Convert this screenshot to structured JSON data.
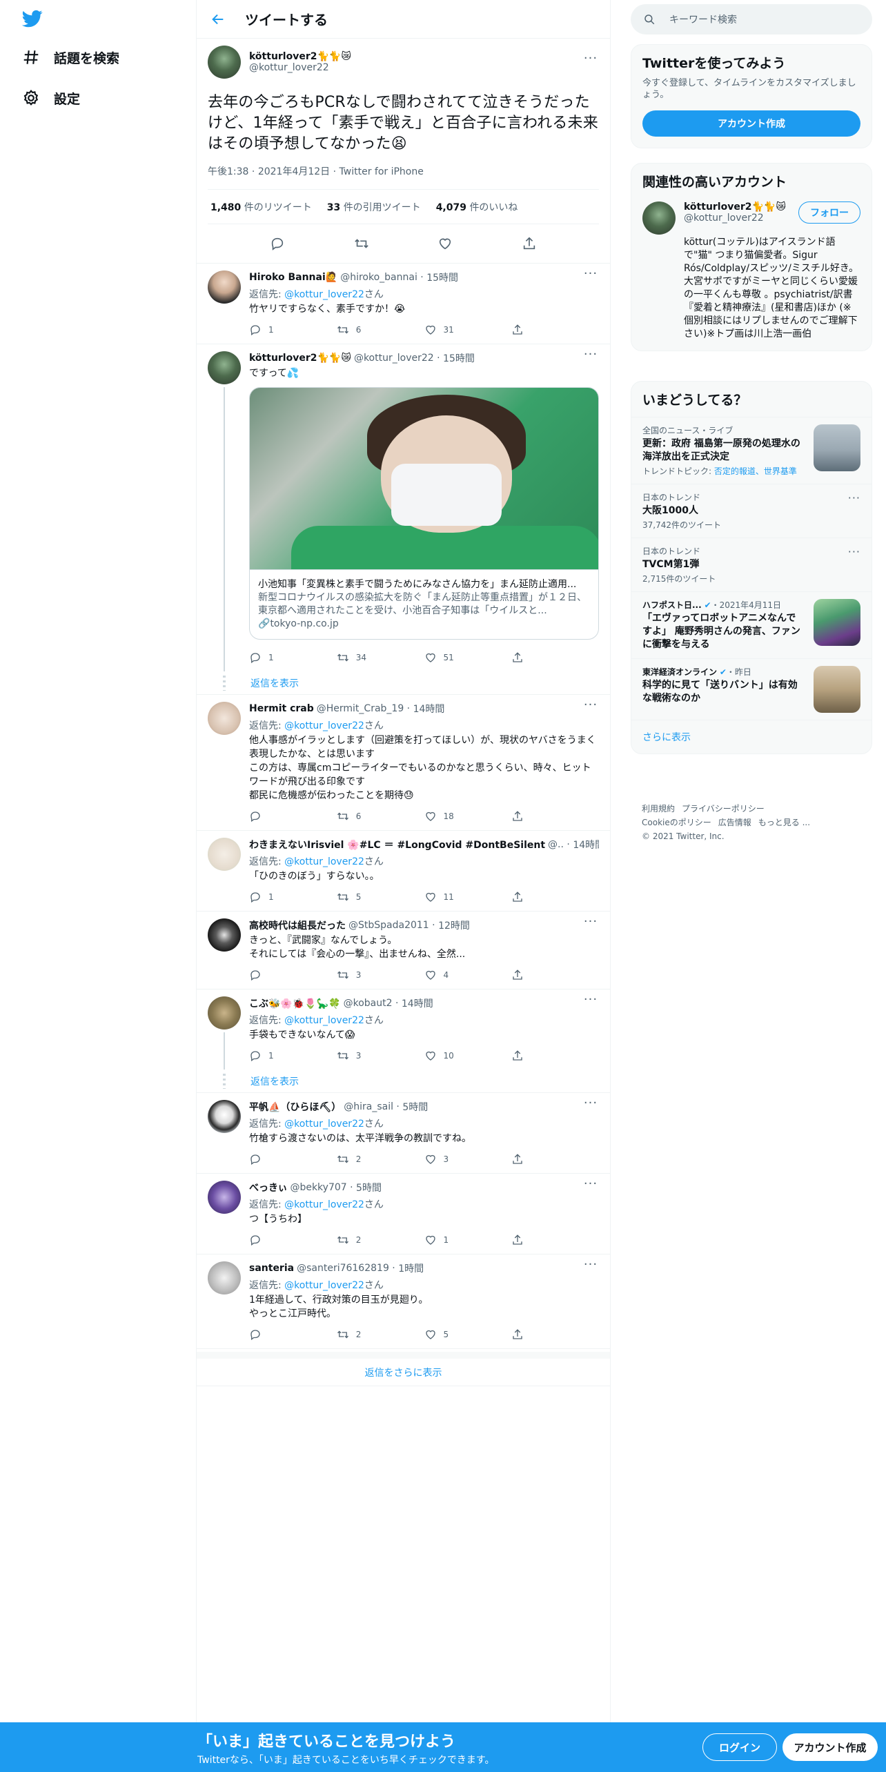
{
  "nav": {
    "explore": "話題を検索",
    "settings": "設定"
  },
  "header": {
    "title": "ツイートする"
  },
  "focal": {
    "name": "kötturlover2🐈🐈😿",
    "handle": "@kottur_lover22",
    "text": "去年の今ごろもPCRなしで闘わされてて泣きそうだったけど、1年経って「素手で戦え」と百合子に言われる未来はその頃予想してなかった😫",
    "time": "午後1:38",
    "date": "2021年4月12日",
    "client": "Twitter for iPhone",
    "retweets": "1,480",
    "retweets_label": "件のリツイート",
    "quotes": "33",
    "quotes_label": "件の引用ツイート",
    "likes": "4,079",
    "likes_label": "件のいいね"
  },
  "replies": [
    {
      "name": "Hiroko Bannai🙋",
      "handle": "@hiroko_bannai",
      "time": "15時間",
      "replyto": "返信先: ",
      "replyto_user": "@kottur_lover22",
      "replyto_suffix": "さん",
      "text": "竹ヤリですらなく、素手ですか！😭",
      "reply_count": "1",
      "rt_count": "6",
      "like_count": "31"
    },
    {
      "name": "kötturlover2🐈🐈😿",
      "handle": "@kottur_lover22",
      "time": "15時間",
      "text": "ですって💦",
      "reply_count": "1",
      "rt_count": "34",
      "like_count": "51",
      "card": {
        "title": "小池知事「変異株と素手で闘うためにみなさん協力を」まん延防止適用...",
        "desc": "新型コロナウイルスの感染拡大を防ぐ「まん延防止等重点措置」が１２日、東京都へ適用されたことを受け、小池百合子知事は「ウイルスと...",
        "url": "tokyo-np.co.jp"
      }
    },
    {
      "name": "Hermit crab",
      "handle": "@Hermit_Crab_19",
      "time": "14時間",
      "replyto": "返信先: ",
      "replyto_user": "@kottur_lover22",
      "replyto_suffix": "さん",
      "text": "他人事感がイラッとします（回避策を打ってほしい）が、現状のヤバさをうまく表現したかな、とは思います\nこの方は、専属cmコピーライターでもいるのかなと思うくらい、時々、ヒットワードが飛び出る印象です\n都民に危機感が伝わったことを期待😓",
      "reply_count": "",
      "rt_count": "6",
      "like_count": "18"
    },
    {
      "name": "わきまえないIrisviel 🌸#LC ＝ #LongCovid #DontBeSilent",
      "handle": "@..",
      "time": "14時間",
      "replyto": "返信先: ",
      "replyto_user": "@kottur_lover22",
      "replyto_suffix": "さん",
      "text": "「ひのきのぼう」すらない。。",
      "reply_count": "1",
      "rt_count": "5",
      "like_count": "11"
    },
    {
      "name": "高校時代は組長だった",
      "handle": "@StbSpada2011",
      "time": "12時間",
      "text": "きっと、『武闘家』なんでしょう。\nそれにしては『会心の一撃』、出ませんね、全然...",
      "reply_count": "",
      "rt_count": "3",
      "like_count": "4"
    },
    {
      "name": "こぶ🐝🌸🐞🌷🦕🍀",
      "handle": "@kobaut2",
      "time": "14時間",
      "replyto": "返信先: ",
      "replyto_user": "@kottur_lover22",
      "replyto_suffix": "さん",
      "text": "手袋もできないなんて😱",
      "reply_count": "1",
      "rt_count": "3",
      "like_count": "10"
    },
    {
      "name": "平帆⛵（ひらほ⛏）",
      "handle": "@hira_sail",
      "time": "5時間",
      "replyto": "返信先: ",
      "replyto_user": "@kottur_lover22",
      "replyto_suffix": "さん",
      "text": "竹槍すら渡さないのは、太平洋戦争の教訓ですね。",
      "reply_count": "",
      "rt_count": "2",
      "like_count": "3"
    },
    {
      "name": "べっきぃ",
      "handle": "@bekky707",
      "time": "5時間",
      "replyto": "返信先: ",
      "replyto_user": "@kottur_lover22",
      "replyto_suffix": "さん",
      "text": "つ【うちわ】",
      "reply_count": "",
      "rt_count": "2",
      "like_count": "1"
    },
    {
      "name": "santeria",
      "handle": "@santeri76162819",
      "time": "1時間",
      "replyto": "返信先: ",
      "replyto_user": "@kottur_lover22",
      "replyto_suffix": "さん",
      "text": "1年経過して、行政対策の目玉が見廻り。\nやっとこ江戸時代。",
      "reply_count": "",
      "rt_count": "2",
      "like_count": "5"
    }
  ],
  "show_replies": "返信を表示",
  "more_replies": "返信をさらに表示",
  "search": {
    "placeholder": "キーワード検索"
  },
  "signup": {
    "title": "Twitterを使ってみよう",
    "desc": "今すぐ登録して、タイムラインをカスタマイズしましょう。",
    "button": "アカウント作成"
  },
  "relevant": {
    "title": "関連性の高いアカウント",
    "name": "kötturlover2🐈🐈😿",
    "handle": "@kottur_lover22",
    "follow": "フォロー",
    "bio": "köttur(コッテル)はアイスランド語で\"猫\" つまり猫偏愛者。Sigur Rós/Coldplay/スピッツ/ミスチル好き。大宮サポですがミーヤと同じくらい愛媛の一平くんも尊敬 。psychiatrist/訳書 『愛着と精神療法』(星和書店)ほか (※個別相談にはリプしませんのでご理解下さい)※トプ画は川上浩一画伯"
  },
  "trends": {
    "title": "いまどうしてる？",
    "items": [
      {
        "meta": "全国のニュース・ライブ",
        "title": "更新：政府 福島第一原発の処理水の海洋放出を正式決定",
        "sub_prefix": "トレンドトピック: ",
        "sub_links": "否定的報道、世界基準"
      },
      {
        "meta": "日本のトレンド",
        "title": "大阪1000人",
        "sub": "37,742件のツイート"
      },
      {
        "meta": "日本のトレンド",
        "title": "TVCM第1弾",
        "sub": "2,715件のツイート"
      },
      {
        "meta_source": "ハフポスト日...",
        "meta_date": "・2021年4月11日",
        "title": "「エヴァってロボットアニメなんですよ」 庵野秀明さんの発言、ファンに衝撃を与える"
      },
      {
        "meta_source": "東洋経済オンライン",
        "meta_date": "・昨日",
        "title": "科学的に見て「送りバント」は有効な戦術なのか"
      }
    ],
    "more": "さらに表示"
  },
  "footer": {
    "links": [
      "利用規約",
      "プライバシーポリシー",
      "Cookieのポリシー",
      "広告情報",
      "もっと見る ..."
    ],
    "copyright": "© 2021 Twitter, Inc."
  },
  "bottombar": {
    "title": "「いま」起きていることを見つけよう",
    "sub": "Twitterなら、「いま」起きていることをいち早くチェックできます。",
    "login": "ログイン",
    "signup": "アカウント作成"
  }
}
